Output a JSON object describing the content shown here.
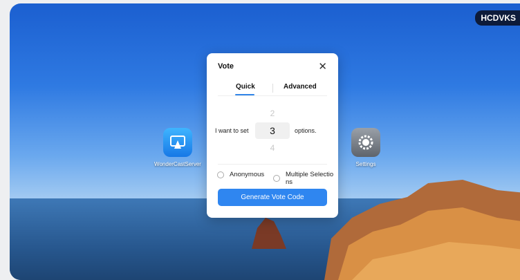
{
  "badge": "HCDVKS",
  "desktop": {
    "icons": [
      {
        "label": "WonderCastServer",
        "icon": "cast-icon"
      },
      {
        "label": "Settings",
        "icon": "gear-icon"
      }
    ]
  },
  "dialog": {
    "title": "Vote",
    "close_icon": "close-icon",
    "tabs": [
      {
        "label": "Quick",
        "active": true
      },
      {
        "label": "Advanced",
        "active": false
      }
    ],
    "picker": {
      "prefix": "I want to set",
      "above": "2",
      "value": "3",
      "below": "4",
      "suffix": "options."
    },
    "options": [
      {
        "label": "Anonymous",
        "checked": false
      },
      {
        "label": "Multiple Selectio ns",
        "checked": false
      }
    ],
    "button": "Generate Vote Code"
  },
  "colors": {
    "accent": "#2f86f0",
    "badge_bg": "#0d1b3a"
  }
}
